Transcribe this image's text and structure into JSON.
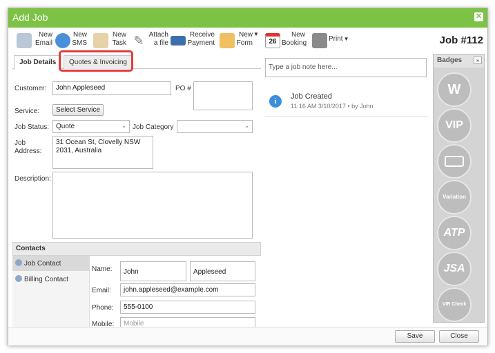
{
  "window": {
    "title": "Add Job",
    "job_number": "Job #112"
  },
  "toolbar": {
    "new_email": "New Email",
    "new_sms": "New SMS",
    "new_task": "New Task",
    "attach_file": "Attach a file",
    "receive_payment": "Receive Payment",
    "new_form": "New Form",
    "new_booking": "New Booking",
    "print": "Print",
    "calendar_day": "26"
  },
  "tabs": {
    "job_details": "Job Details",
    "quotes_invoicing": "Quotes & Invoicing"
  },
  "form": {
    "customer_label": "Customer:",
    "customer_value": "John Appleseed",
    "po_label": "PO #",
    "po_value": "",
    "service_label": "Service:",
    "select_service_button": "Select Service",
    "job_status_label": "Job Status:",
    "job_status_value": "Quote",
    "job_category_label": "Job Category",
    "job_category_value": "",
    "job_address_label": "Job Address:",
    "job_address_line1": "31 Ocean St, Clovelly NSW",
    "job_address_line2": "2031, Australia",
    "description_label": "Description:",
    "description_value": ""
  },
  "contacts": {
    "header": "Contacts",
    "items": [
      "Job Contact",
      "Billing Contact"
    ],
    "name_label": "Name:",
    "first_name": "John",
    "last_name": "Appleseed",
    "email_label": "Email:",
    "email_value": "john.appleseed@example.com",
    "phone_label": "Phone:",
    "phone_value": "555-0100",
    "mobile_label": "Mobile:",
    "mobile_placeholder": "Mobile"
  },
  "notes": {
    "placeholder": "Type a job note here...",
    "activity_title": "Job Created",
    "activity_time": "11:16 AM 3/10/2017",
    "activity_by": "by John"
  },
  "badges": {
    "header": "Badges",
    "expand": "»",
    "items": [
      "W",
      "VIP",
      "",
      "Variation",
      "ATP",
      "JSA",
      "VIR Check"
    ]
  },
  "footer": {
    "save": "Save",
    "close": "Close"
  },
  "colors": {
    "title_bar": "#7cc244",
    "highlight": "#e53b3b",
    "info_icon": "#3a8edc"
  }
}
